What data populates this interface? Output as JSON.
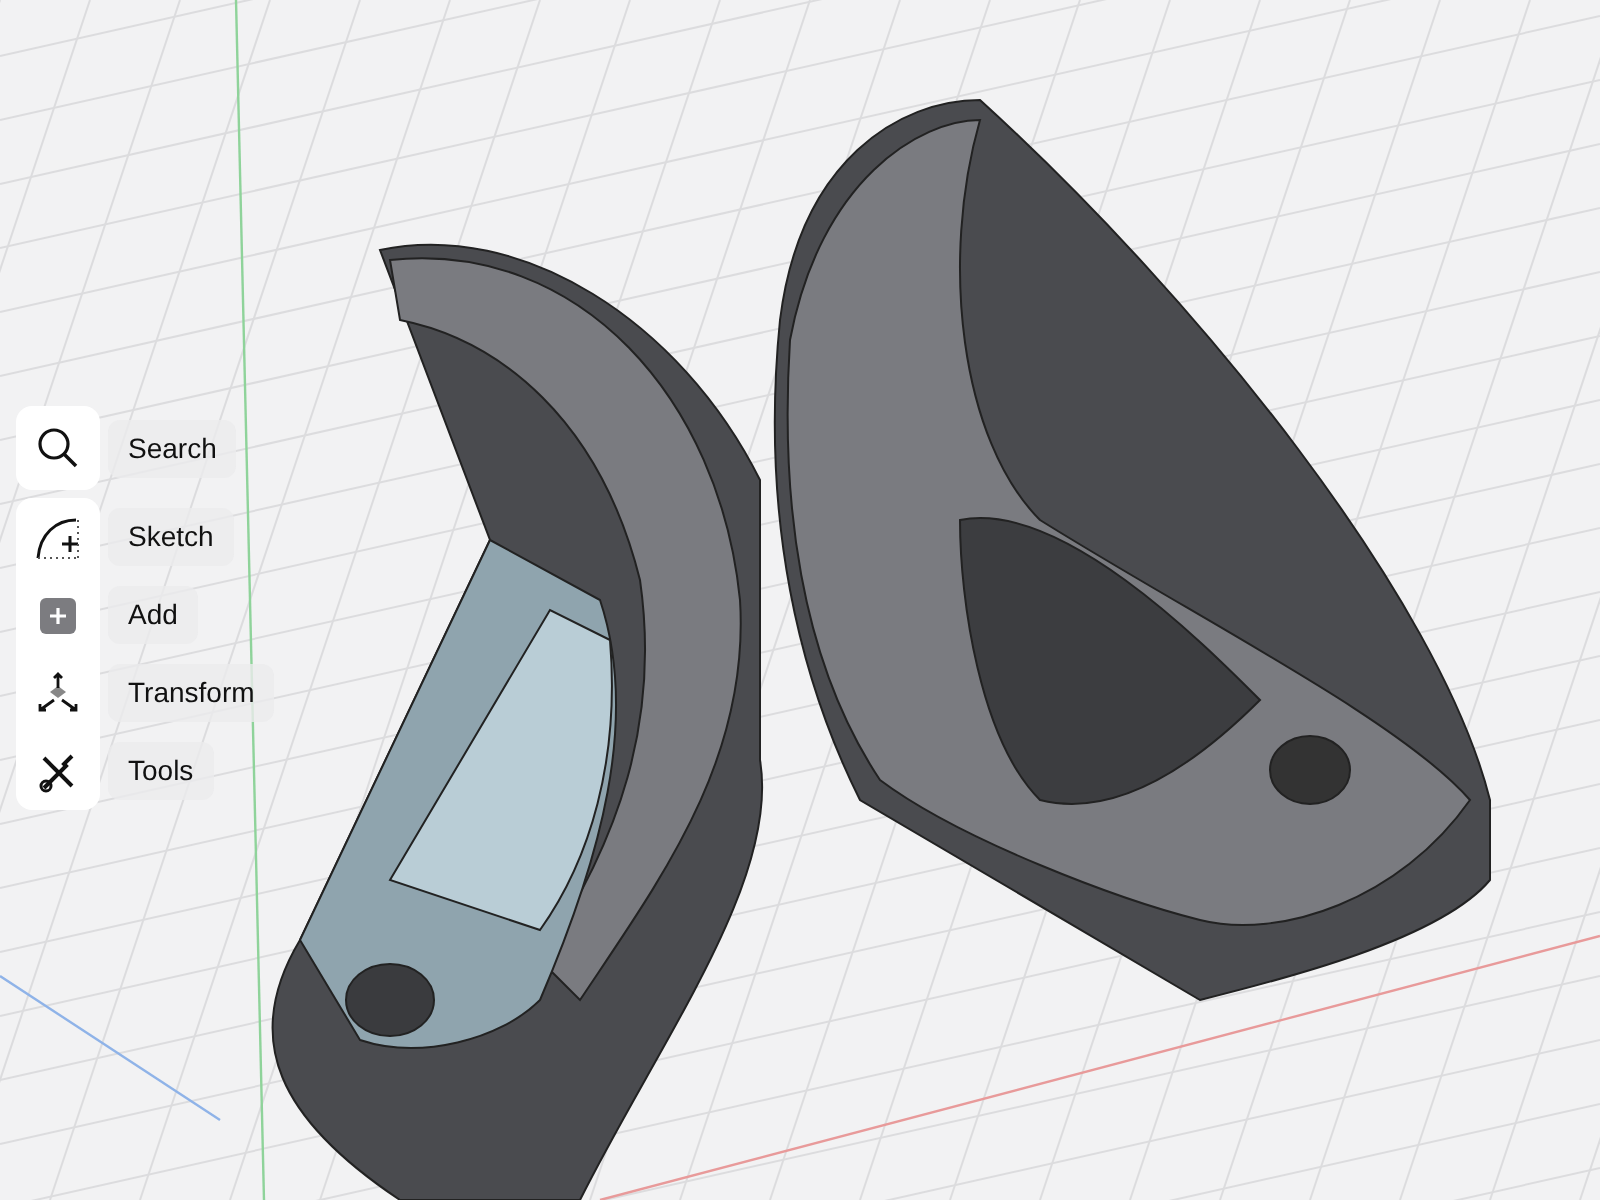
{
  "search": {
    "label": "Search"
  },
  "tools": [
    {
      "label": "Sketch"
    },
    {
      "label": "Add"
    },
    {
      "label": "Transform"
    },
    {
      "label": "Tools"
    }
  ]
}
